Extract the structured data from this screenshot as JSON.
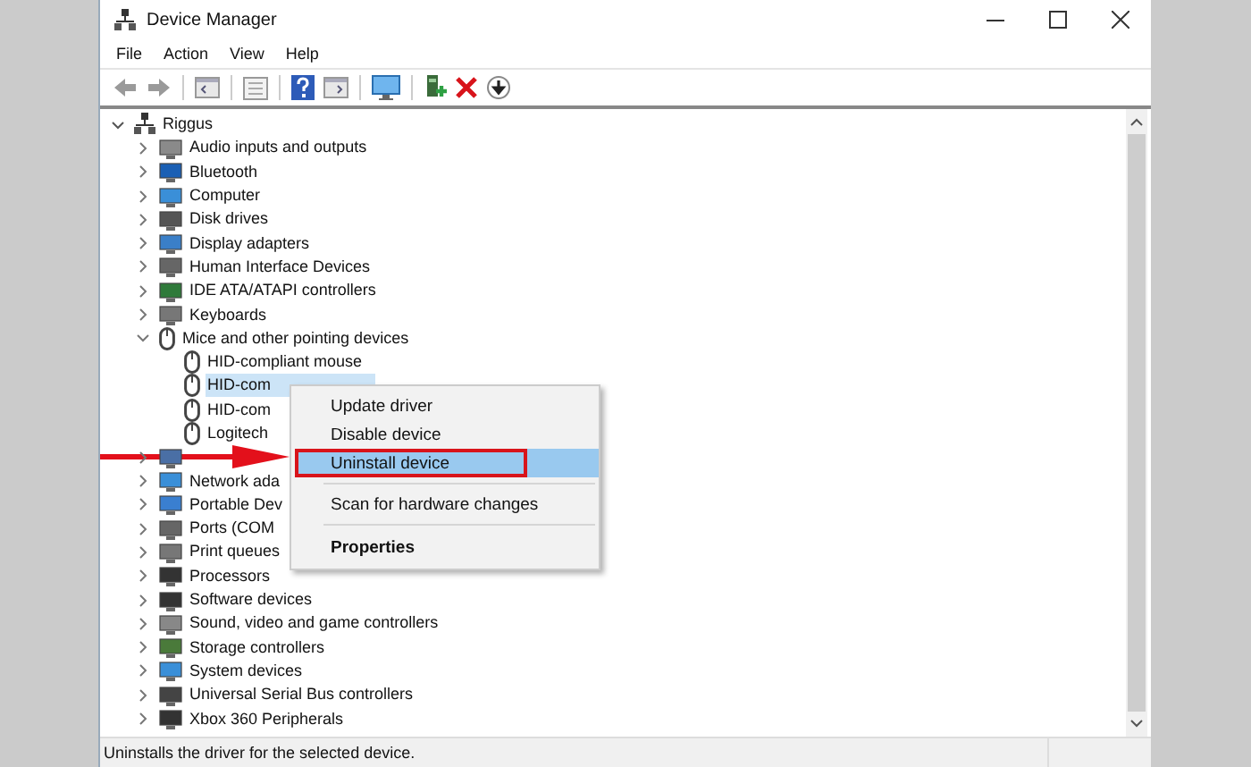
{
  "window": {
    "title": "Device Manager"
  },
  "menu_bar": [
    "File",
    "Action",
    "View",
    "Help"
  ],
  "tree": {
    "label": "Riggus",
    "expanded": true,
    "children": [
      {
        "label": "Audio inputs and outputs",
        "expanded": false
      },
      {
        "label": "Bluetooth",
        "expanded": false
      },
      {
        "label": "Computer",
        "expanded": false
      },
      {
        "label": "Disk drives",
        "expanded": false
      },
      {
        "label": "Display adapters",
        "expanded": false
      },
      {
        "label": "Human Interface Devices",
        "expanded": false
      },
      {
        "label": "IDE ATA/ATAPI controllers",
        "expanded": false
      },
      {
        "label": "Keyboards",
        "expanded": false
      },
      {
        "label": "Mice and other pointing devices",
        "expanded": true,
        "children": [
          {
            "label": "HID-compliant mouse",
            "selected": false
          },
          {
            "label": "HID-com",
            "selected": true
          },
          {
            "label": "HID-com",
            "selected": false
          },
          {
            "label": "Logitech",
            "selected": false
          }
        ]
      },
      {
        "expanded": false
      },
      {
        "label": "Network ada",
        "expanded": false
      },
      {
        "label": "Portable Dev",
        "expanded": false
      },
      {
        "label": "Ports (COM",
        "expanded": false
      },
      {
        "label": "Print queues",
        "expanded": false
      },
      {
        "label": "Processors",
        "expanded": false
      },
      {
        "label": "Software devices",
        "expanded": false
      },
      {
        "label": "Sound, video and game controllers",
        "expanded": false
      },
      {
        "label": "Storage controllers",
        "expanded": false
      },
      {
        "label": "System devices",
        "expanded": false
      },
      {
        "label": "Universal Serial Bus controllers",
        "expanded": false
      },
      {
        "label": "Xbox 360 Peripherals",
        "expanded": false
      }
    ]
  },
  "context_menu": [
    {
      "label": "Update driver",
      "kind": "item",
      "selected": false
    },
    {
      "label": "Disable device",
      "kind": "item",
      "selected": false
    },
    {
      "label": "Uninstall device",
      "kind": "item",
      "selected": true
    },
    {
      "kind": "separator"
    },
    {
      "label": "Scan for hardware changes",
      "kind": "item",
      "selected": false
    },
    {
      "kind": "separator"
    },
    {
      "label": "Properties",
      "kind": "default",
      "selected": false
    }
  ],
  "status_bar": "Uninstalls the driver for the selected device."
}
